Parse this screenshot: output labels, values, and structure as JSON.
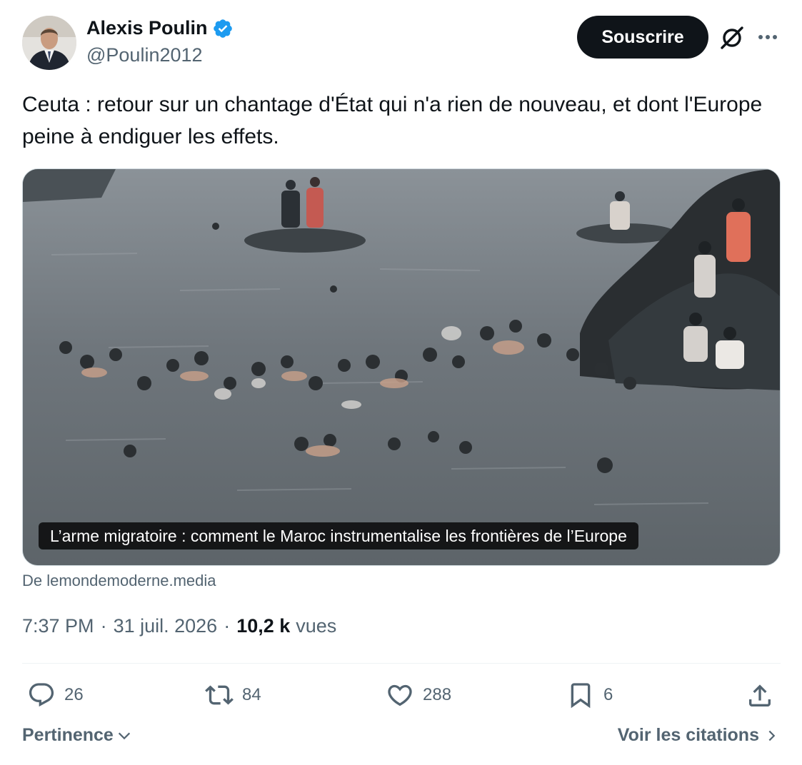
{
  "author": {
    "name": "Alexis Poulin",
    "handle": "@Poulin2012",
    "verified": true,
    "verified_color": "#1d9bf0"
  },
  "header": {
    "subscribe_label": "Souscrire",
    "icons": [
      "grok-icon",
      "more-icon"
    ]
  },
  "tweet": {
    "text": "Ceuta : retour sur un chantage d'État qui n'a rien de nouveau, et dont l'Europe peine à endiguer les effets."
  },
  "media": {
    "caption": "L’arme migratoire : comment le Maroc instrumentalise les frontières de l’Europe",
    "source": "De lemondemoderne.media"
  },
  "meta": {
    "time": "7:37 PM",
    "separator": "·",
    "date": "31 juil. 2026",
    "views_count": "10,2 k",
    "views_label": "vues"
  },
  "actions": {
    "replies": "26",
    "reposts": "84",
    "likes": "288",
    "bookmarks": "6"
  },
  "footer": {
    "sort_label": "Pertinence",
    "quotes_label": "Voir les citations"
  },
  "colors": {
    "text_primary": "#0f1419",
    "text_secondary": "#536471",
    "button_bg": "#0f1419",
    "border": "#cfd9de"
  }
}
